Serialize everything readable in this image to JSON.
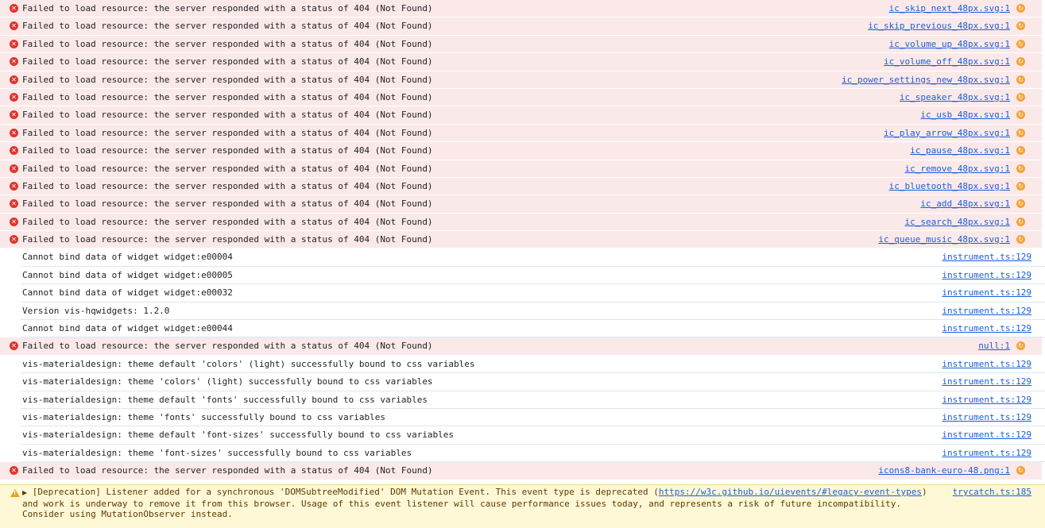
{
  "messages": [
    {
      "type": "error",
      "text": "Failed to load resource: the server responded with a status of 404 (Not Found)",
      "source": "ic_skip_next_48px.svg:1"
    },
    {
      "type": "error",
      "text": "Failed to load resource: the server responded with a status of 404 (Not Found)",
      "source": "ic_skip_previous_48px.svg:1"
    },
    {
      "type": "error",
      "text": "Failed to load resource: the server responded with a status of 404 (Not Found)",
      "source": "ic_volume_up_48px.svg:1"
    },
    {
      "type": "error",
      "text": "Failed to load resource: the server responded with a status of 404 (Not Found)",
      "source": "ic_volume_off_48px.svg:1"
    },
    {
      "type": "error",
      "text": "Failed to load resource: the server responded with a status of 404 (Not Found)",
      "source": "ic_power_settings_new_48px.svg:1"
    },
    {
      "type": "error",
      "text": "Failed to load resource: the server responded with a status of 404 (Not Found)",
      "source": "ic_speaker_48px.svg:1"
    },
    {
      "type": "error",
      "text": "Failed to load resource: the server responded with a status of 404 (Not Found)",
      "source": "ic_usb_48px.svg:1"
    },
    {
      "type": "error",
      "text": "Failed to load resource: the server responded with a status of 404 (Not Found)",
      "source": "ic_play_arrow_48px.svg:1"
    },
    {
      "type": "error",
      "text": "Failed to load resource: the server responded with a status of 404 (Not Found)",
      "source": "ic_pause_48px.svg:1"
    },
    {
      "type": "error",
      "text": "Failed to load resource: the server responded with a status of 404 (Not Found)",
      "source": "ic_remove_48px.svg:1"
    },
    {
      "type": "error",
      "text": "Failed to load resource: the server responded with a status of 404 (Not Found)",
      "source": "ic_bluetooth_48px.svg:1"
    },
    {
      "type": "error",
      "text": "Failed to load resource: the server responded with a status of 404 (Not Found)",
      "source": "ic_add_48px.svg:1"
    },
    {
      "type": "error",
      "text": "Failed to load resource: the server responded with a status of 404 (Not Found)",
      "source": "ic_search_48px.svg:1"
    },
    {
      "type": "error",
      "text": "Failed to load resource: the server responded with a status of 404 (Not Found)",
      "source": "ic_queue_music_48px.svg:1"
    },
    {
      "type": "info",
      "text": "Cannot bind data of widget widget:e00004",
      "source": "instrument.ts:129"
    },
    {
      "type": "info",
      "text": "Cannot bind data of widget widget:e00005",
      "source": "instrument.ts:129"
    },
    {
      "type": "info",
      "text": "Cannot bind data of widget widget:e00032",
      "source": "instrument.ts:129"
    },
    {
      "type": "info",
      "text": "Version vis-hqwidgets: 1.2.0",
      "source": "instrument.ts:129"
    },
    {
      "type": "info",
      "text": "Cannot bind data of widget widget:e00044",
      "source": "instrument.ts:129"
    },
    {
      "type": "error",
      "text": "Failed to load resource: the server responded with a status of 404 (Not Found)",
      "source": "null:1"
    },
    {
      "type": "info",
      "text": "vis-materialdesign: theme default 'colors' (light) successfully bound to css variables",
      "source": "instrument.ts:129"
    },
    {
      "type": "info",
      "text": "vis-materialdesign: theme 'colors' (light) successfully bound to css variables",
      "source": "instrument.ts:129"
    },
    {
      "type": "info",
      "text": "vis-materialdesign: theme default 'fonts' successfully bound to css variables",
      "source": "instrument.ts:129"
    },
    {
      "type": "info",
      "text": "vis-materialdesign: theme 'fonts' successfully bound to css variables",
      "source": "instrument.ts:129"
    },
    {
      "type": "info",
      "text": "vis-materialdesign: theme default 'font-sizes' successfully bound to css variables",
      "source": "instrument.ts:129"
    },
    {
      "type": "info",
      "text": "vis-materialdesign: theme 'font-sizes' successfully bound to css variables",
      "source": "instrument.ts:129"
    },
    {
      "type": "error",
      "text": "Failed to load resource: the server responded with a status of 404 (Not Found)",
      "source": "icons8-bank-euro-48.png:1"
    }
  ],
  "warning": {
    "text_before": "[Deprecation] Listener added for a synchronous 'DOMSubtreeModified' DOM Mutation Event. This event type is deprecated (",
    "link": "https://w3c.github.io/uievents/#legacy-event-types",
    "text_after": ") and work is underway to remove it from this browser. Usage of this event listener will cause performance issues today, and represents a risk of future incompatibility. Consider using MutationObserver instead.",
    "source": "trycatch.ts:185"
  },
  "icons": {
    "error": "error-circle-icon",
    "warning": "warning-triangle-icon",
    "reveal": "reveal-source-icon",
    "expand": "expand-triangle-icon"
  },
  "colors": {
    "error_bg": "#fbe9ea",
    "error_icon": "#dc362e",
    "warning_bg": "#fff8d6",
    "link": "#1a5fd8",
    "reveal_icon": "#f3a33a"
  }
}
